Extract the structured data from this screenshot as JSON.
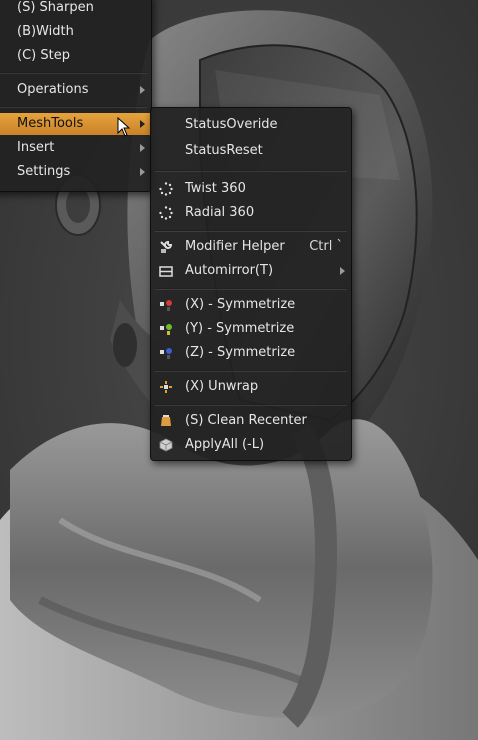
{
  "main_menu": {
    "items": [
      {
        "label": "(S) Sharpen"
      },
      {
        "label": "(B)Width"
      },
      {
        "label": "(C) Step"
      },
      {
        "label": "Operations"
      },
      {
        "label": "MeshTools"
      },
      {
        "label": "Insert"
      },
      {
        "label": "Settings"
      }
    ]
  },
  "submenu": {
    "items": [
      {
        "label": "StatusOveride"
      },
      {
        "label": "StatusReset"
      },
      {
        "label": "Twist 360",
        "icon": "spin-dots-icon"
      },
      {
        "label": "Radial 360",
        "icon": "spin-dots-icon"
      },
      {
        "label": "Modifier Helper",
        "shortcut": "Ctrl `",
        "icon": "modifier-wrench-icon"
      },
      {
        "label": "Automirror(T)",
        "icon": "mirror-box-icon"
      },
      {
        "label": "(X) - Symmetrize",
        "icon": "symmetrize-x-icon"
      },
      {
        "label": "(Y) - Symmetrize",
        "icon": "symmetrize-y-icon"
      },
      {
        "label": "(Z) - Symmetrize",
        "icon": "symmetrize-z-icon"
      },
      {
        "label": "(X) Unwrap",
        "icon": "unwrap-icon"
      },
      {
        "label": "(S) Clean Recenter",
        "icon": "clean-recenter-icon"
      },
      {
        "label": "ApplyAll (-L)",
        "icon": "apply-all-cube-icon"
      }
    ]
  },
  "colors": {
    "highlight": "#e0993a",
    "menu_bg": "#222222",
    "text": "#e6e6e6"
  }
}
